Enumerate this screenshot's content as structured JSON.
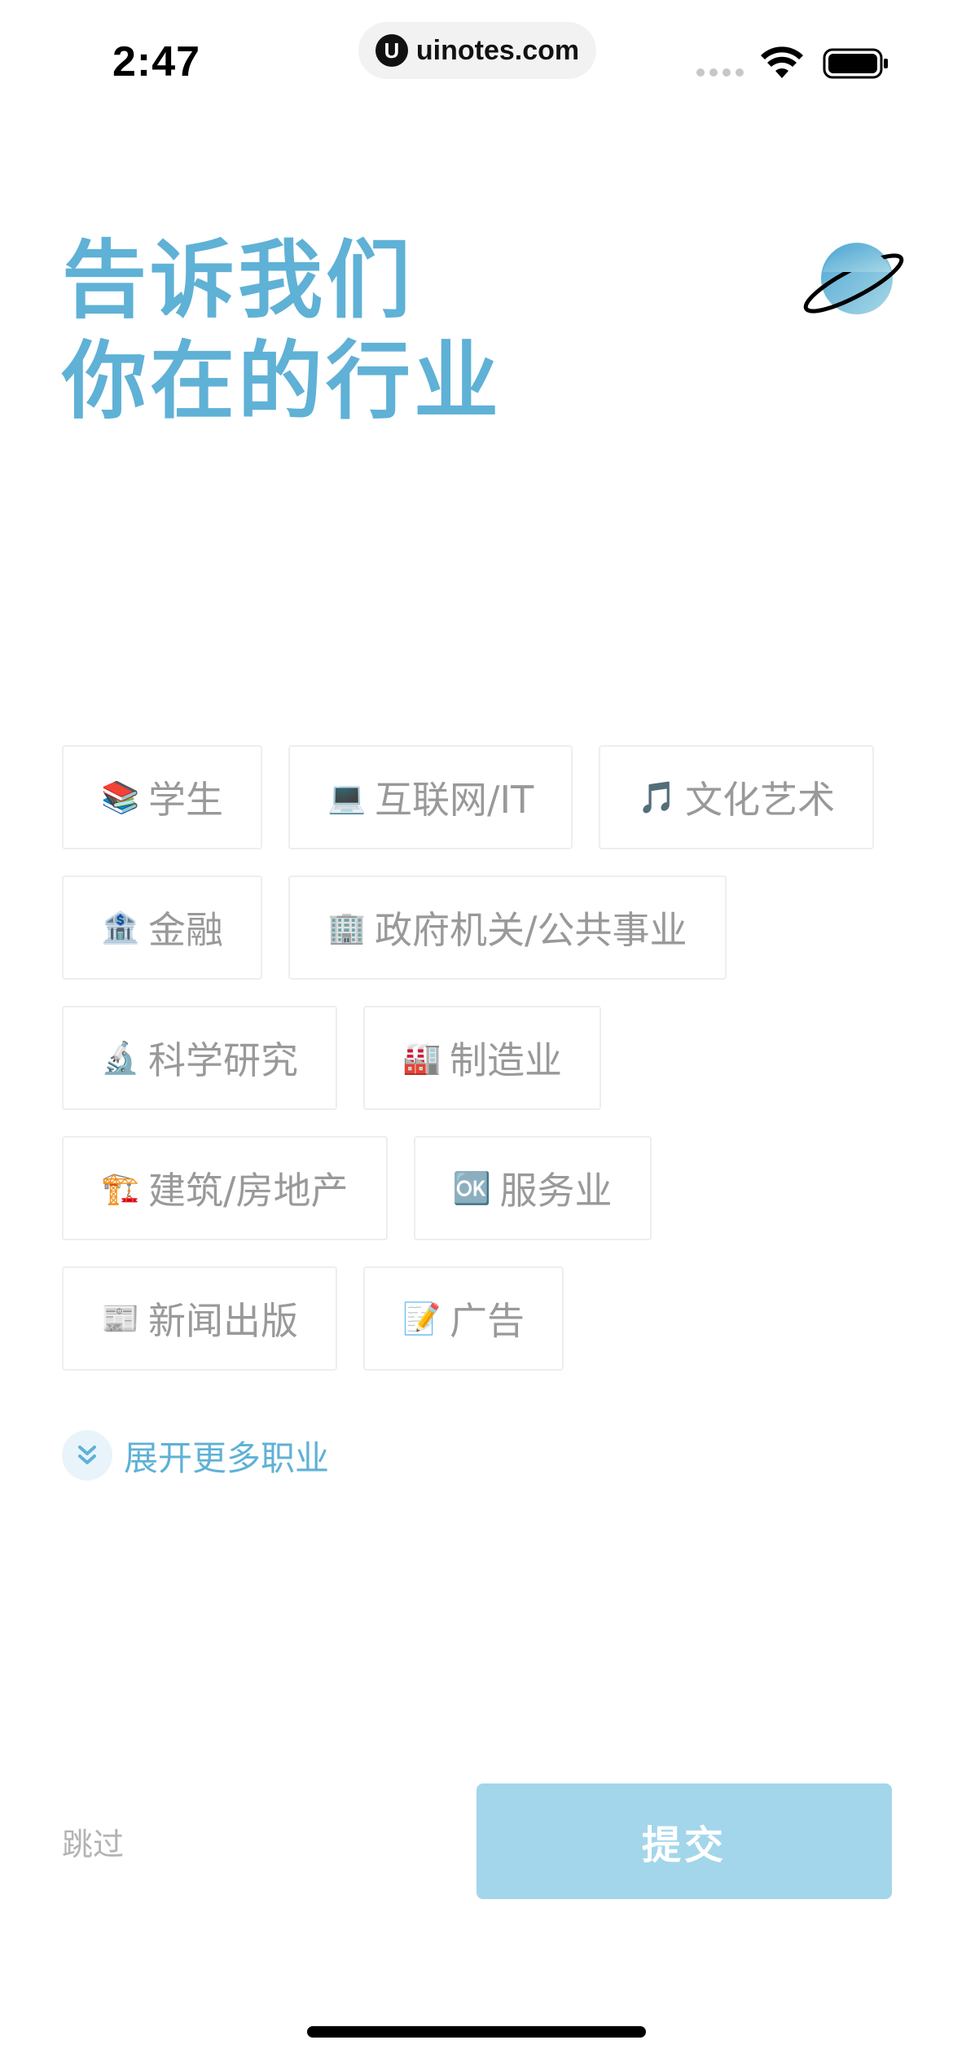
{
  "status_bar": {
    "time": "2:47",
    "url": "uinotes.com",
    "url_logo": "U"
  },
  "header": {
    "title_line1": "告诉我们",
    "title_line2": "你在的行业",
    "icon": "planet-icon"
  },
  "industries": [
    [
      {
        "emoji": "📚",
        "label": "学生"
      },
      {
        "emoji": "💻",
        "label": "互联网/IT"
      },
      {
        "emoji": "🎵",
        "label": "文化艺术"
      }
    ],
    [
      {
        "emoji": "🏦",
        "label": "金融"
      },
      {
        "emoji": "🏢",
        "label": "政府机关/公共事业"
      }
    ],
    [
      {
        "emoji": "🔬",
        "label": "科学研究"
      },
      {
        "emoji": "🏭",
        "label": "制造业"
      }
    ],
    [
      {
        "emoji": "🏗️",
        "label": "建筑/房地产"
      },
      {
        "emoji": "🆗",
        "label": "服务业"
      }
    ],
    [
      {
        "emoji": "📰",
        "label": "新闻出版"
      },
      {
        "emoji": "📝",
        "label": "广告"
      }
    ]
  ],
  "expand": {
    "label": "展开更多职业",
    "icon": "double-chevron-down-icon"
  },
  "footer": {
    "skip_label": "跳过",
    "submit_label": "提交"
  },
  "colors": {
    "accent": "#5fb1d6",
    "submit_bg": "#a3d6eb",
    "tag_text": "#999999",
    "tag_border": "#eeeeee"
  }
}
